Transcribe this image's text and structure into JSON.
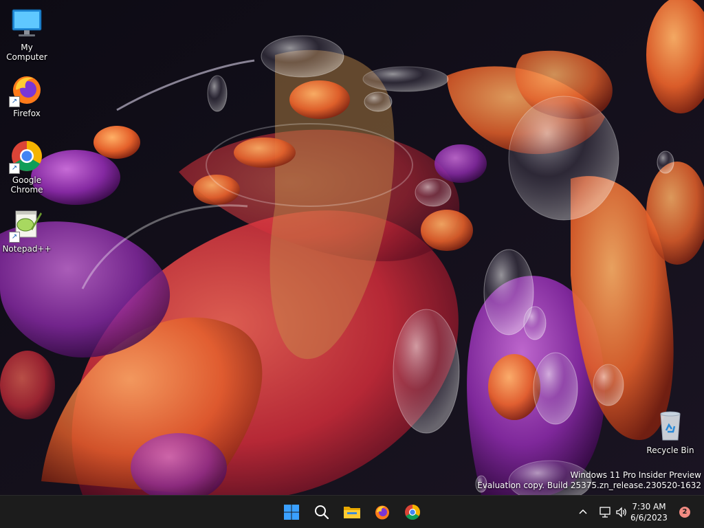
{
  "desktop": {
    "icons": [
      {
        "label": "My Computer",
        "icon": "computer-icon"
      },
      {
        "label": "Firefox",
        "icon": "firefox-icon"
      },
      {
        "label": "Google\nChrome",
        "icon": "chrome-icon"
      },
      {
        "label": "Notepad++",
        "icon": "notepadpp-icon"
      },
      {
        "label": "Recycle Bin",
        "icon": "recycle-bin-icon"
      }
    ],
    "watermark": {
      "line1": "Windows 11 Pro Insider Preview",
      "line2": "Evaluation copy. Build 25375.zn_release.230520-1632"
    }
  },
  "taskbar": {
    "apps": [
      "start-icon",
      "search-icon",
      "file-explorer-icon",
      "firefox-icon",
      "chrome-icon"
    ],
    "tray": {
      "time": "7:30 AM",
      "date": "6/6/2023",
      "notification_count": "2"
    }
  },
  "colors": {
    "taskbar": "#1c1c1c",
    "start_blue": "#3aa0ff",
    "notification_badge": "#f28b82"
  }
}
